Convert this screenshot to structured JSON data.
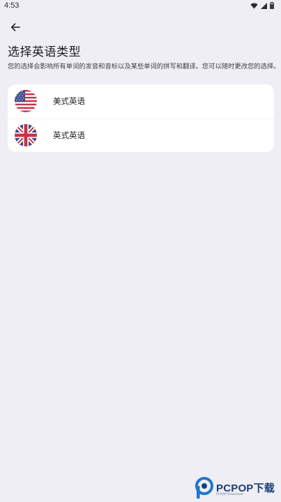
{
  "status_bar": {
    "time": "4:53",
    "icons": [
      "wifi-icon",
      "signal-icon",
      "battery-icon"
    ]
  },
  "header": {
    "back_icon": "arrow-left-icon",
    "title": "选择英语类型",
    "subtitle": "您的选择会影响所有单词的发音和音标以及某些单词的拼写和翻译。您可以随时更改您的选择。"
  },
  "options": [
    {
      "label": "美式英语",
      "flag_icon": "us-flag-icon"
    },
    {
      "label": "英式英语",
      "flag_icon": "uk-flag-icon"
    }
  ],
  "watermark": {
    "text": "PCPOP下载",
    "sub": "PCPOP Download"
  },
  "colors": {
    "background": "#efeef5",
    "card": "#ffffff",
    "watermark": "#1a3f73"
  }
}
